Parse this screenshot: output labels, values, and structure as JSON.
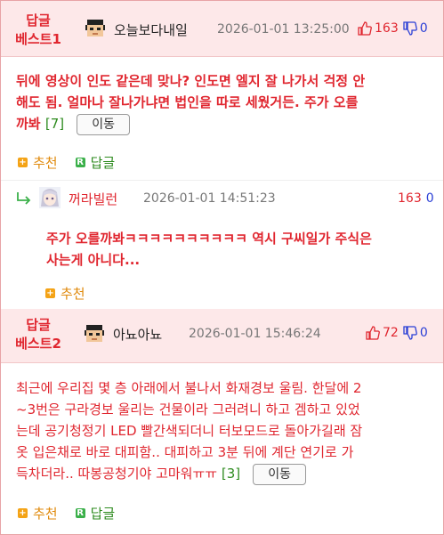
{
  "comments": [
    {
      "best_label": "답글\n베스트1",
      "best_line1": "답글",
      "best_line2": "베스트1",
      "nickname": "오늘보다내일",
      "datetime": "2026-01-01 13:25:00",
      "upvotes": "163",
      "downvotes": "0",
      "text": "뒤에 영상이 인도 같은데 맞나? 인도면 엘지 잘 나가서 걱정 안 해도 됨. 얼마나 잘나가냐면 법인을 따로 세웠거든. 주가 오를 까봐",
      "text_line1": "뒤에 영상이 인도 같은데 맞나? 인도면 엘지 잘 나가서 걱정 안",
      "text_line2": "해도 됨. 얼마나 잘나가냐면 법인을 따로 세웠거든. 주가 오를",
      "text_line3": "까봐",
      "reply_count": "[7]",
      "move_label": "이동",
      "recommend_label": "추천",
      "reply_label": "답글"
    },
    {
      "best_line1": "답글",
      "best_line2": "베스트2",
      "nickname": "아뇨아뇨",
      "datetime": "2026-01-01 15:46:24",
      "upvotes": "72",
      "downvotes": "0",
      "text_line1": "최근에 우리집 몇 층 아래에서 불나서 화재경보 울림. 한달에 2",
      "text_line2": "~3번은 구라경보 울리는 건물이라 그러려니 하고 겜하고 있었",
      "text_line3": "는데 공기청정기 LED 빨간색되더니 터보모드로 돌아가길래 잠",
      "text_line4": "옷 입은채로 바로 대피함.. 대피하고 3분 뒤에 계단 연기로 가",
      "text_line5": "득차더라.. 따봉공청기야 고마워ㅠㅠ",
      "reply_count": "[3]",
      "move_label": "이동",
      "recommend_label": "추천",
      "reply_label": "답글"
    }
  ],
  "reply": {
    "nickname": "꺼라빌런",
    "datetime": "2026-01-01 14:51:23",
    "upvotes": "163",
    "downvotes": "0",
    "text_line1": "주가 오를까봐ㅋㅋㅋㅋㅋㅋㅋㅋㅋㅋ 역시 구씨일가 주식은",
    "text_line2": "사는게 아니다...",
    "recommend_label": "추천"
  },
  "colors": {
    "accent_red": "#e0262f",
    "header_bg": "#fde8e9",
    "border": "#e8a3a6",
    "down_blue": "#2a3fd6",
    "recommend_orange": "#f4a316",
    "reply_green": "#3bb04a"
  },
  "icons": {
    "thumbs_up": "thumbs-up-icon",
    "thumbs_down": "thumbs-down-icon",
    "reply_arrow": "reply-arrow-icon",
    "recommend": "plus-square-icon",
    "reply": "r-square-icon"
  }
}
